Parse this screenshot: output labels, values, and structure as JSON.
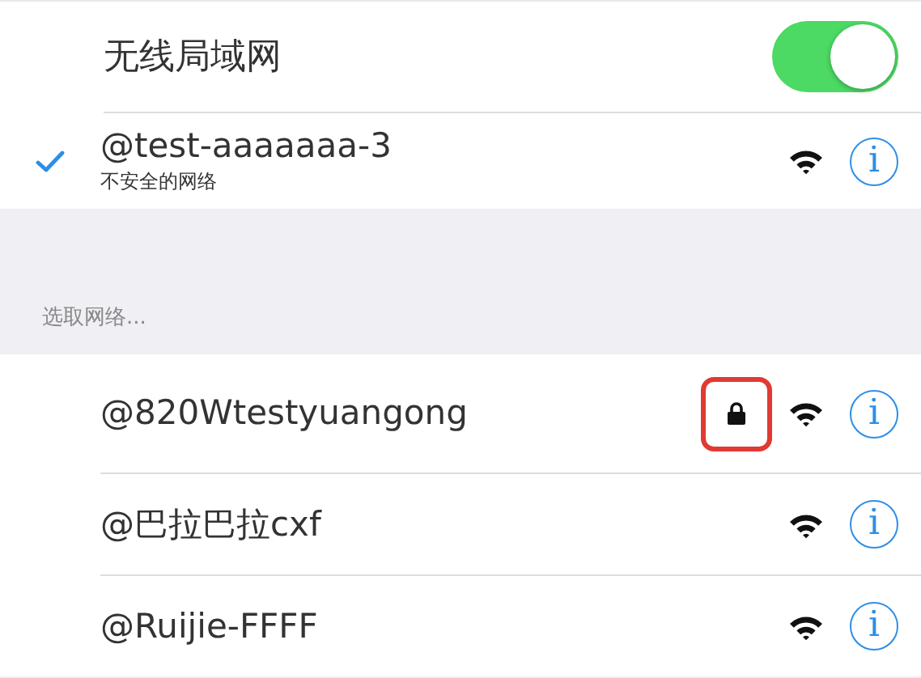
{
  "wifi": {
    "label": "无线局域网",
    "on": true
  },
  "current_network": {
    "name": "@test-aaaaaaa-3",
    "subtitle": "不安全的网络",
    "selected": true,
    "info": "i"
  },
  "section_header": "选取网络...",
  "networks": [
    {
      "name": "@820Wtestyuangong",
      "locked": true,
      "highlighted": true,
      "info": "i"
    },
    {
      "name": "@巴拉巴拉cxf",
      "locked": false,
      "highlighted": false,
      "info": "i"
    },
    {
      "name": "@Ruijie-FFFF",
      "locked": false,
      "highlighted": false,
      "info": "i"
    }
  ]
}
